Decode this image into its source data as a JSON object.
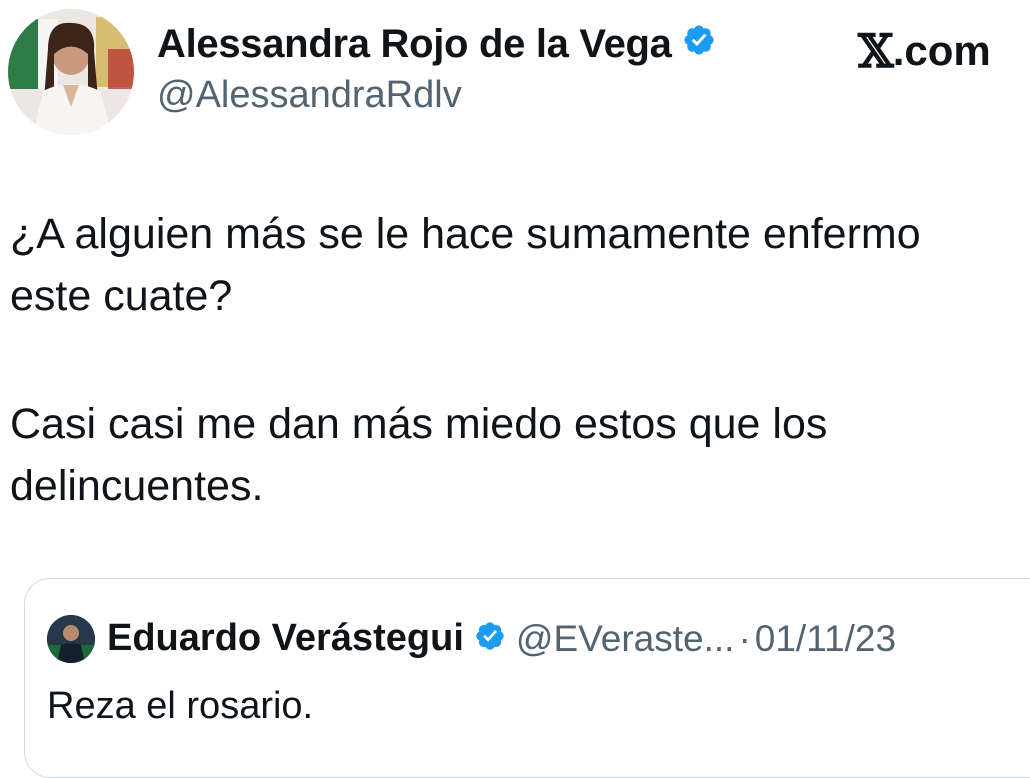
{
  "author": {
    "display_name": "Alessandra Rojo de la Vega",
    "handle": "@AlessandraRdlv",
    "verified_icon": "verified-badge-icon",
    "avatar_icon": "profile-photo"
  },
  "brand": {
    "x_glyph": "𝕏",
    "domain": ".com"
  },
  "tweet": {
    "paragraph_1": "¿A alguien más se le hace sumamente enfermo\neste cuate?",
    "paragraph_2": "Casi casi me dan más miedo estos que los\ndelincuentes."
  },
  "quoted_tweet": {
    "display_name": "Eduardo Verástegui",
    "handle": "@EVeraste...",
    "separator": "·",
    "date": "01/11/23",
    "text": "Reza el rosario."
  },
  "colors": {
    "text": "#0f1419",
    "secondary": "#536471",
    "verified_blue": "#1d9bf0",
    "border": "#cfd9de"
  }
}
